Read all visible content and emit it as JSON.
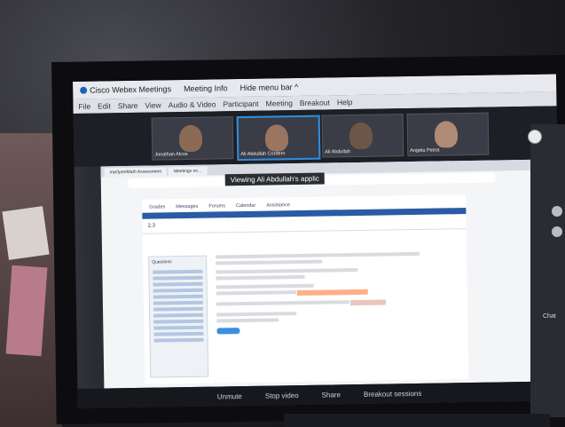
{
  "menubar": {
    "app": "Cisco Webex Meetings",
    "meeting_info": "Meeting Info",
    "hide_menu": "Hide menu bar ^"
  },
  "menu": {
    "items": [
      "File",
      "Edit",
      "Share",
      "View",
      "Audio & Video",
      "Participant",
      "Meeting",
      "Breakout",
      "Help"
    ]
  },
  "participants": [
    {
      "name": "Jonathan Alcos"
    },
    {
      "name": "Ali Abdullah Cordero"
    },
    {
      "name": "Ali Abdullah"
    },
    {
      "name": "Angela Petrot"
    }
  ],
  "share": {
    "viewing": "Viewing Ali Abdullah's applic"
  },
  "browser": {
    "tabs": [
      "myOpenMath Assessment",
      "Meetings on..."
    ]
  },
  "lms": {
    "nav": [
      "Grades",
      "Messages",
      "Forums",
      "Calendar",
      "Assistance"
    ],
    "section": "2.3",
    "sidebar_title": "Questions"
  },
  "controls": {
    "unmute": "Unmute",
    "stop_video": "Stop video",
    "share": "Share",
    "breakout": "Breakout sessions"
  },
  "side": {
    "chat": "Chat"
  }
}
